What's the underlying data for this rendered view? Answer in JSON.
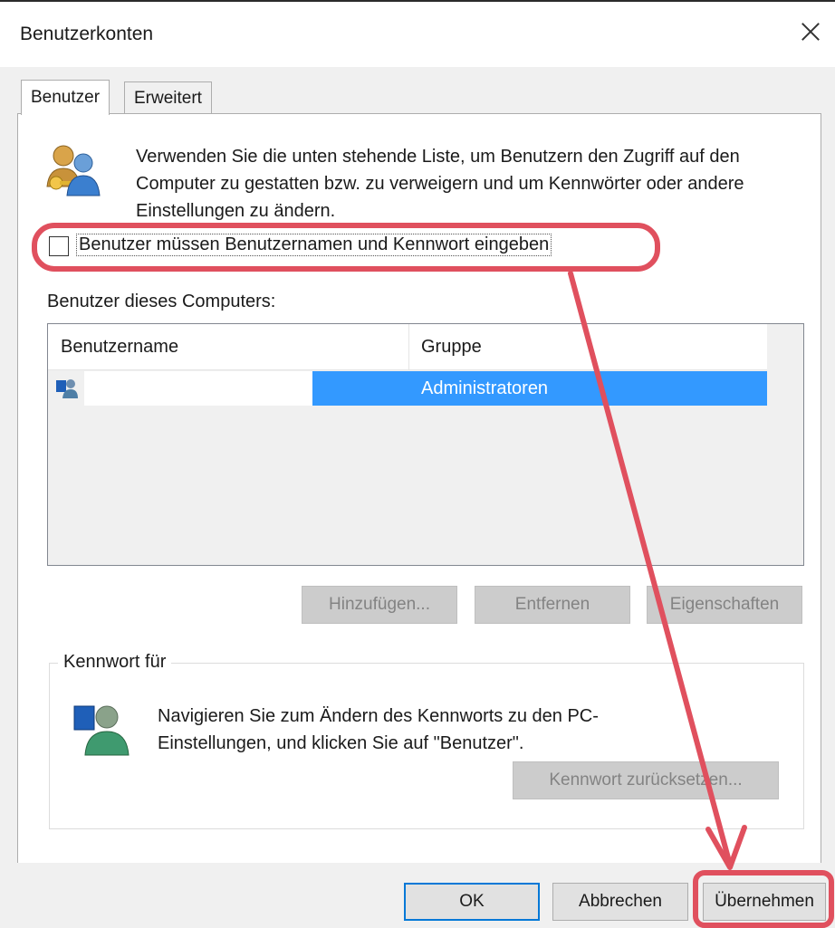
{
  "window": {
    "title": "Benutzerkonten"
  },
  "tabs": [
    {
      "label": "Benutzer"
    },
    {
      "label": "Erweitert"
    }
  ],
  "users_tab": {
    "description": "Verwenden Sie die unten stehende Liste, um Benutzern den Zugriff auf den Computer zu gestatten bzw. zu verweigern und um Kennwörter oder andere Einstellungen zu ändern.",
    "require_login_checkbox": {
      "label": "Benutzer müssen Benutzernamen und Kennwort eingeben",
      "checked": false
    },
    "list_label": "Benutzer dieses Computers:",
    "columns": [
      "Benutzername",
      "Gruppe"
    ],
    "rows": [
      {
        "username": "",
        "group": "Administratoren",
        "selected": true
      }
    ],
    "buttons": {
      "add": "Hinzufügen...",
      "remove": "Entfernen",
      "properties": "Eigenschaften"
    },
    "password_group": {
      "legend": "Kennwort für",
      "info": "Navigieren Sie zum Ändern des Kennworts zu den PC-Einstellungen, und klicken Sie auf \"Benutzer\".",
      "reset_button": "Kennwort zurücksetzen..."
    }
  },
  "dialog_buttons": {
    "ok": "OK",
    "cancel": "Abbrechen",
    "apply": "Übernehmen"
  },
  "colors": {
    "selection": "#3399ff",
    "annotation": "#e0505e",
    "focus_border": "#0078d7"
  },
  "icons": [
    "users-key-icon",
    "user-row-icon",
    "user-password-icon",
    "close-icon"
  ]
}
